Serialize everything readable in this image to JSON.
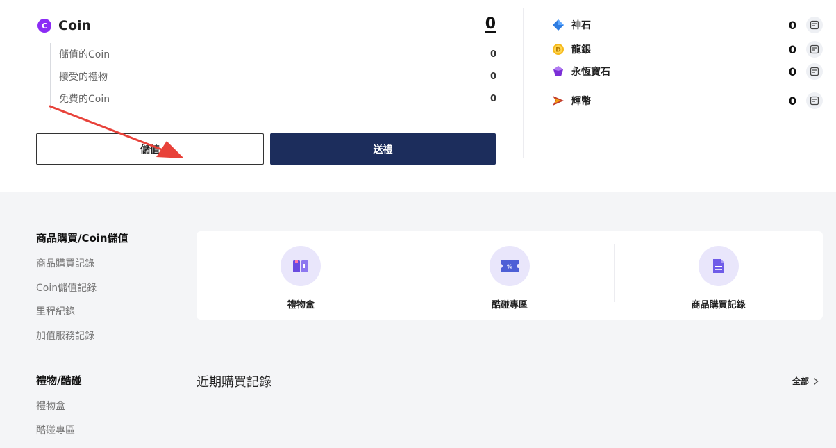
{
  "coin": {
    "icon_letter": "C",
    "label": "Coin",
    "total": "0",
    "breakdown": [
      {
        "label": "儲值的Coin",
        "value": "0"
      },
      {
        "label": "接受的禮物",
        "value": "0"
      },
      {
        "label": "免費的Coin",
        "value": "0"
      }
    ],
    "charge_label": "儲值",
    "gift_label": "送禮"
  },
  "currencies": [
    {
      "name": "神石",
      "value": "0",
      "icon": "blue-diamond-icon"
    },
    {
      "name": "龍銀",
      "value": "0",
      "icon": "gold-coin-icon"
    },
    {
      "name": "永恆寶石",
      "value": "0",
      "icon": "purple-gem-icon"
    },
    {
      "name": "輝幣",
      "value": "0",
      "icon": "glory-coin-icon"
    }
  ],
  "sidebar": {
    "sections": [
      {
        "title": "商品購買/Coin儲值",
        "items": [
          "商品購買記錄",
          "Coin儲值記錄",
          "里程紀錄",
          "加值服務記錄"
        ]
      },
      {
        "title": "禮物/酷碰",
        "items": [
          "禮物盒",
          "酷碰專區"
        ]
      }
    ]
  },
  "quick_links": [
    {
      "label": "禮物盒",
      "icon": "gift-box-icon"
    },
    {
      "label": "酷碰專區",
      "icon": "coupon-icon"
    },
    {
      "label": "商品購買記錄",
      "icon": "purchase-record-icon"
    }
  ],
  "recent": {
    "title": "近期購買記錄",
    "all_label": "全部"
  },
  "colors": {
    "primary": "#1c2d5c",
    "coin_purple": "#8b2cf5",
    "annotation_red": "#e8423a",
    "icon_bg": "#e9e6fb"
  }
}
